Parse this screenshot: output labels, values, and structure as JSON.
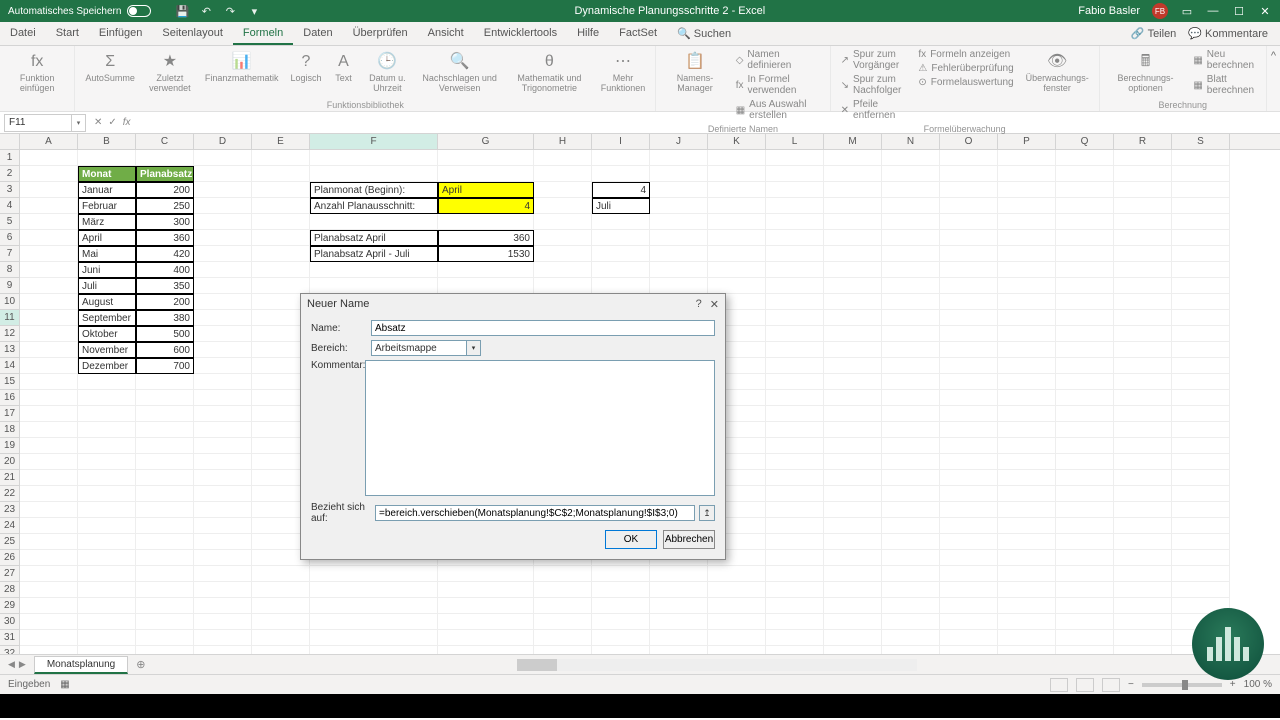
{
  "titlebar": {
    "autosave_label": "Automatisches Speichern",
    "title_center": "Dynamische Planungsschritte 2  -  Excel",
    "user_name": "Fabio Basler",
    "user_initials": "FB"
  },
  "tabs": {
    "list": [
      "Datei",
      "Start",
      "Einfügen",
      "Seitenlayout",
      "Formeln",
      "Daten",
      "Überprüfen",
      "Ansicht",
      "Entwicklertools",
      "Hilfe",
      "FactSet"
    ],
    "active": "Formeln",
    "search": "Suchen",
    "share": "Teilen",
    "comments": "Kommentare"
  },
  "ribbon": {
    "g1": {
      "b1": "Funktion\neinfügen"
    },
    "g2": {
      "b1": "AutoSumme",
      "b2": "Zuletzt\nverwendet",
      "label": ""
    },
    "g3": {
      "b1": "Finanzmathematik",
      "b2": "Logisch",
      "b3": "Text",
      "b4": "Datum u.\nUhrzeit",
      "b5": "Nachschlagen\nund Verweisen",
      "b6": "Mathematik und\nTrigonometrie",
      "b7": "Mehr\nFunktionen",
      "label": "Funktionsbibliothek"
    },
    "g4": {
      "b1": "Namens-\nManager",
      "s1": "Namen definieren",
      "s2": "In Formel verwenden",
      "s3": "Aus Auswahl erstellen",
      "label": "Definierte Namen"
    },
    "g5": {
      "s1": "Spur zum Vorgänger",
      "s2": "Spur zum Nachfolger",
      "s3": "Pfeile entfernen",
      "s4": "Formeln anzeigen",
      "s5": "Fehlerüberprüfung",
      "s6": "Formelauswertung",
      "b1": "Überwachungs-\nfenster",
      "label": "Formelüberwachung"
    },
    "g6": {
      "b1": "Berechnungs-\noptionen",
      "s1": "Neu berechnen",
      "s2": "Blatt berechnen",
      "label": "Berechnung"
    }
  },
  "namebox": "F11",
  "columns": [
    "A",
    "B",
    "C",
    "D",
    "E",
    "F",
    "G",
    "H",
    "I",
    "J",
    "K",
    "L",
    "M",
    "N",
    "O",
    "P",
    "Q",
    "R",
    "S"
  ],
  "table": {
    "header_month": "Monat",
    "header_plan": "Planabsatz",
    "rows": [
      {
        "m": "Januar",
        "v": 200
      },
      {
        "m": "Februar",
        "v": 250
      },
      {
        "m": "März",
        "v": 300
      },
      {
        "m": "April",
        "v": 360
      },
      {
        "m": "Mai",
        "v": 420
      },
      {
        "m": "Juni",
        "v": 400
      },
      {
        "m": "Juli",
        "v": 350
      },
      {
        "m": "August",
        "v": 200
      },
      {
        "m": "September",
        "v": 380
      },
      {
        "m": "Oktober",
        "v": 500
      },
      {
        "m": "November",
        "v": 600
      },
      {
        "m": "Dezember",
        "v": 700
      }
    ]
  },
  "plan": {
    "label_begin": "Planmonat (Beginn):",
    "val_begin": "April",
    "label_count": "Anzahl Planausschnitt:",
    "val_count": 4,
    "label_single": "Planabsatz April",
    "val_single": 360,
    "label_range": "Planabsatz April - Juli",
    "val_range": 1530,
    "ref_num": 4,
    "ref_month": "Juli"
  },
  "dialog": {
    "title": "Neuer Name",
    "name_label": "Name:",
    "name_value": "Absatz",
    "scope_label": "Bereich:",
    "scope_value": "Arbeitsmappe",
    "comment_label": "Kommentar:",
    "refers_label": "Bezieht sich auf:",
    "refers_value": "=bereich.verschieben(Monatsplanung!$C$2;Monatsplanung!$I$3;0)",
    "ok": "OK",
    "cancel": "Abbrechen",
    "help": "?",
    "close": "✕"
  },
  "sheet": {
    "name": "Monatsplanung"
  },
  "status": {
    "mode": "Eingeben",
    "zoom": "100 %"
  }
}
